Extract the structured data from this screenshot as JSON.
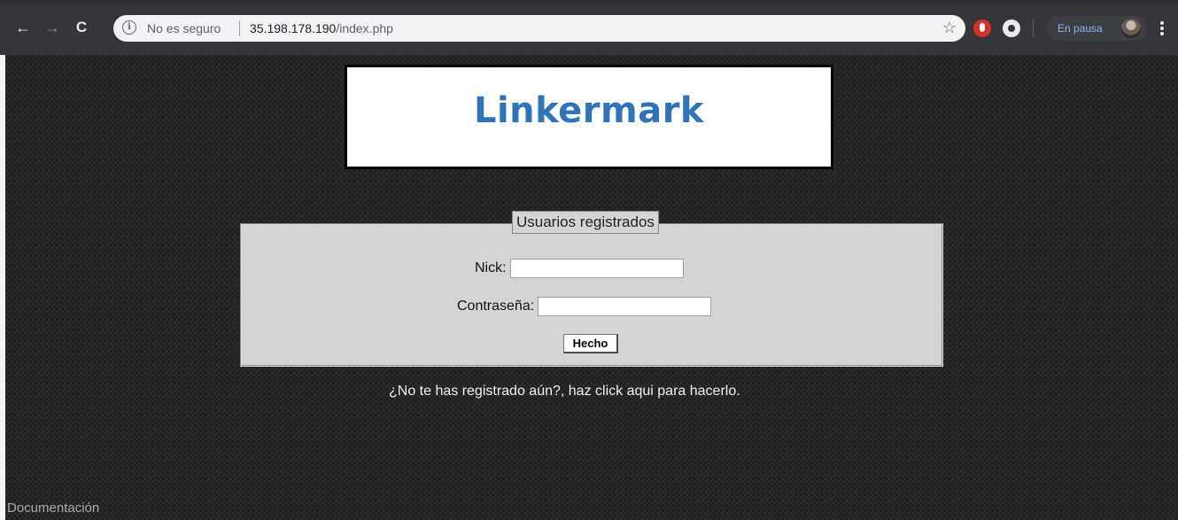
{
  "browser": {
    "back_icon": "arrow-left",
    "forward_icon": "arrow-right",
    "reload_icon": "reload",
    "info_icon": "info-circle",
    "security_text": "No es seguro",
    "url_host": "35.198.178.190",
    "url_path": "/index.php",
    "bookmark_icon": "star",
    "extensions": [
      "red-hand-extension-icon",
      "gear-extension-icon"
    ],
    "profile_status": "En pausa",
    "menu_icon": "vertical-dots"
  },
  "page": {
    "logo_text": "Linkermark",
    "logo_color": "#3073b8",
    "login_form": {
      "legend": "Usuarios registrados",
      "nick_label": "Nick:",
      "nick_value": "",
      "password_label": "Contraseña:",
      "password_value": "",
      "submit_label": "Hecho"
    },
    "register_prompt": "¿No te has registrado aún?, haz click aqui para hacerlo.",
    "footer_link": "Documentación"
  }
}
